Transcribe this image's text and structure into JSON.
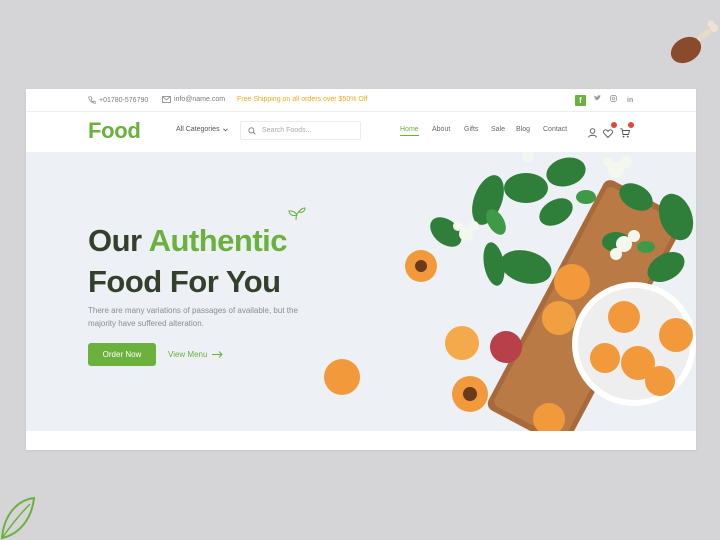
{
  "topbar": {
    "phone": "+01780-576790",
    "email": "info@name.com",
    "promo": "Free Shipping on all orders over $50% Off",
    "social": [
      "facebook-icon",
      "twitter-icon",
      "instagram-icon",
      "linkedin-icon"
    ]
  },
  "header": {
    "logo": "Food",
    "category_label": "All Categories",
    "search_placeholder": "Search Foods...",
    "nav": [
      "Home",
      "About",
      "Gifts",
      "Sale",
      "Blog",
      "Contact"
    ],
    "active_nav": "Home"
  },
  "hero": {
    "title_part1": "Our ",
    "title_part2": "Authentic",
    "title_line2": "Food For You",
    "description": "There are many variations of passages of available, but the majority have suffered alteration.",
    "primary_button": "Order Now",
    "secondary_button": "View Menu"
  },
  "colors": {
    "accent": "#6ab23d",
    "promo": "#f2a91e",
    "title": "#34402c",
    "badge": "#e5463a",
    "apricot": "#f29a3b"
  }
}
